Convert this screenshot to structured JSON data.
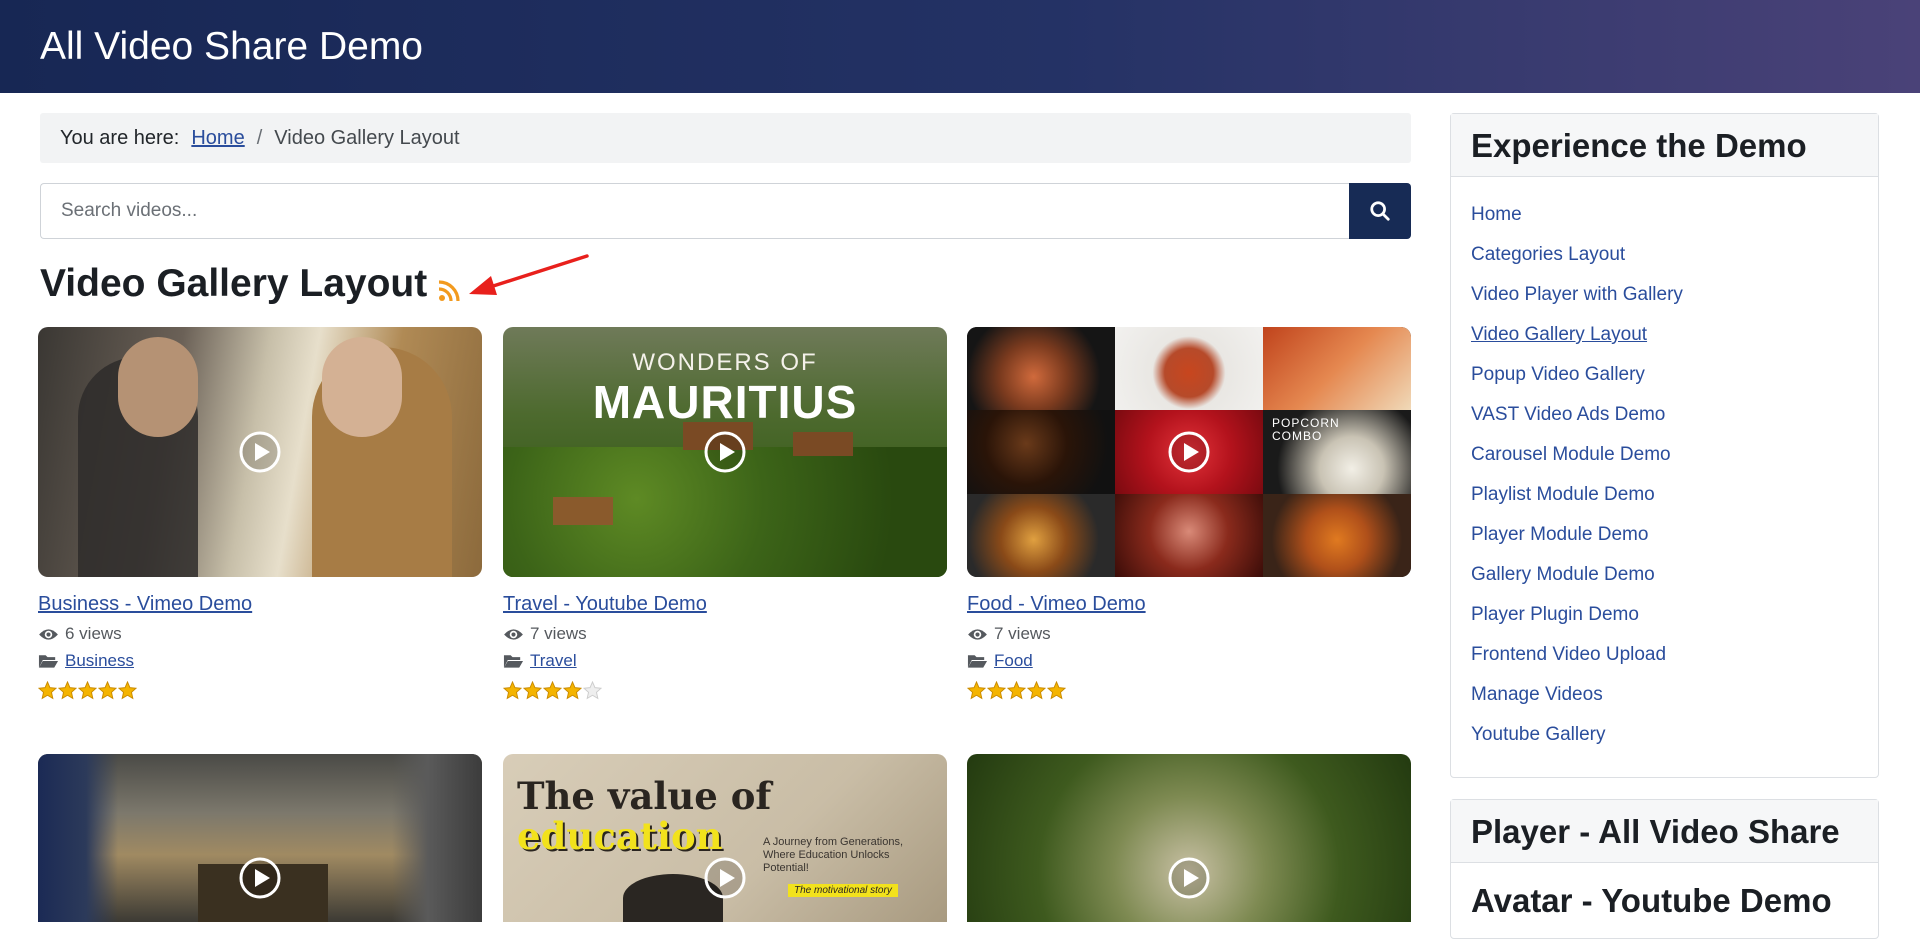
{
  "header": {
    "site_title": "All Video Share Demo"
  },
  "breadcrumb": {
    "prefix": "You are here:",
    "home": "Home",
    "separator": "/",
    "current": "Video Gallery Layout"
  },
  "search": {
    "placeholder": "Search videos...",
    "button_icon": "search-icon"
  },
  "page": {
    "title": "Video Gallery Layout",
    "feed_icon": "rss-icon"
  },
  "videos": [
    {
      "title": "Business - Vimeo Demo",
      "views": "6 views",
      "category": "Business",
      "rating": 5
    },
    {
      "title": "Travel - Youtube Demo",
      "views": "7 views",
      "category": "Travel",
      "rating": 4
    },
    {
      "title": "Food - Vimeo Demo",
      "views": "7 views",
      "category": "Food",
      "rating": 5
    },
    {
      "thumb_text": ""
    },
    {
      "thumb_text_1": "The value of",
      "thumb_text_2": "education",
      "thumb_text_3": "A Journey from Generations, Where Education Unlocks Potential!",
      "thumb_text_4": "The motivational story"
    },
    {
      "thumb_text": ""
    }
  ],
  "thumb_text": {
    "travel_1": "WONDERS OF",
    "travel_2": "MAURITIUS",
    "food_popcorn": "POPCORN COMBO"
  },
  "sidebar": {
    "heading": "Experience the Demo",
    "items": [
      "Home",
      "Categories Layout",
      "Video Player with Gallery",
      "Video Gallery Layout",
      "Popup Video Gallery",
      "VAST Video Ads Demo",
      "Carousel Module Demo",
      "Playlist Module Demo",
      "Player Module Demo",
      "Gallery Module Demo",
      "Player Plugin Demo",
      "Frontend Video Upload",
      "Manage Videos",
      "Youtube Gallery"
    ],
    "active_index": 3,
    "second_heading": "Player - All Video Share",
    "second_subheading": "Avatar - Youtube Demo"
  },
  "colors": {
    "header_gradient_start": "#172754",
    "header_gradient_end": "#4a4278",
    "link": "#2a4d9c",
    "search_button": "#172b55",
    "rss": "#f29a1e",
    "annotation_arrow": "#e8201c",
    "star": "#f4b400"
  }
}
